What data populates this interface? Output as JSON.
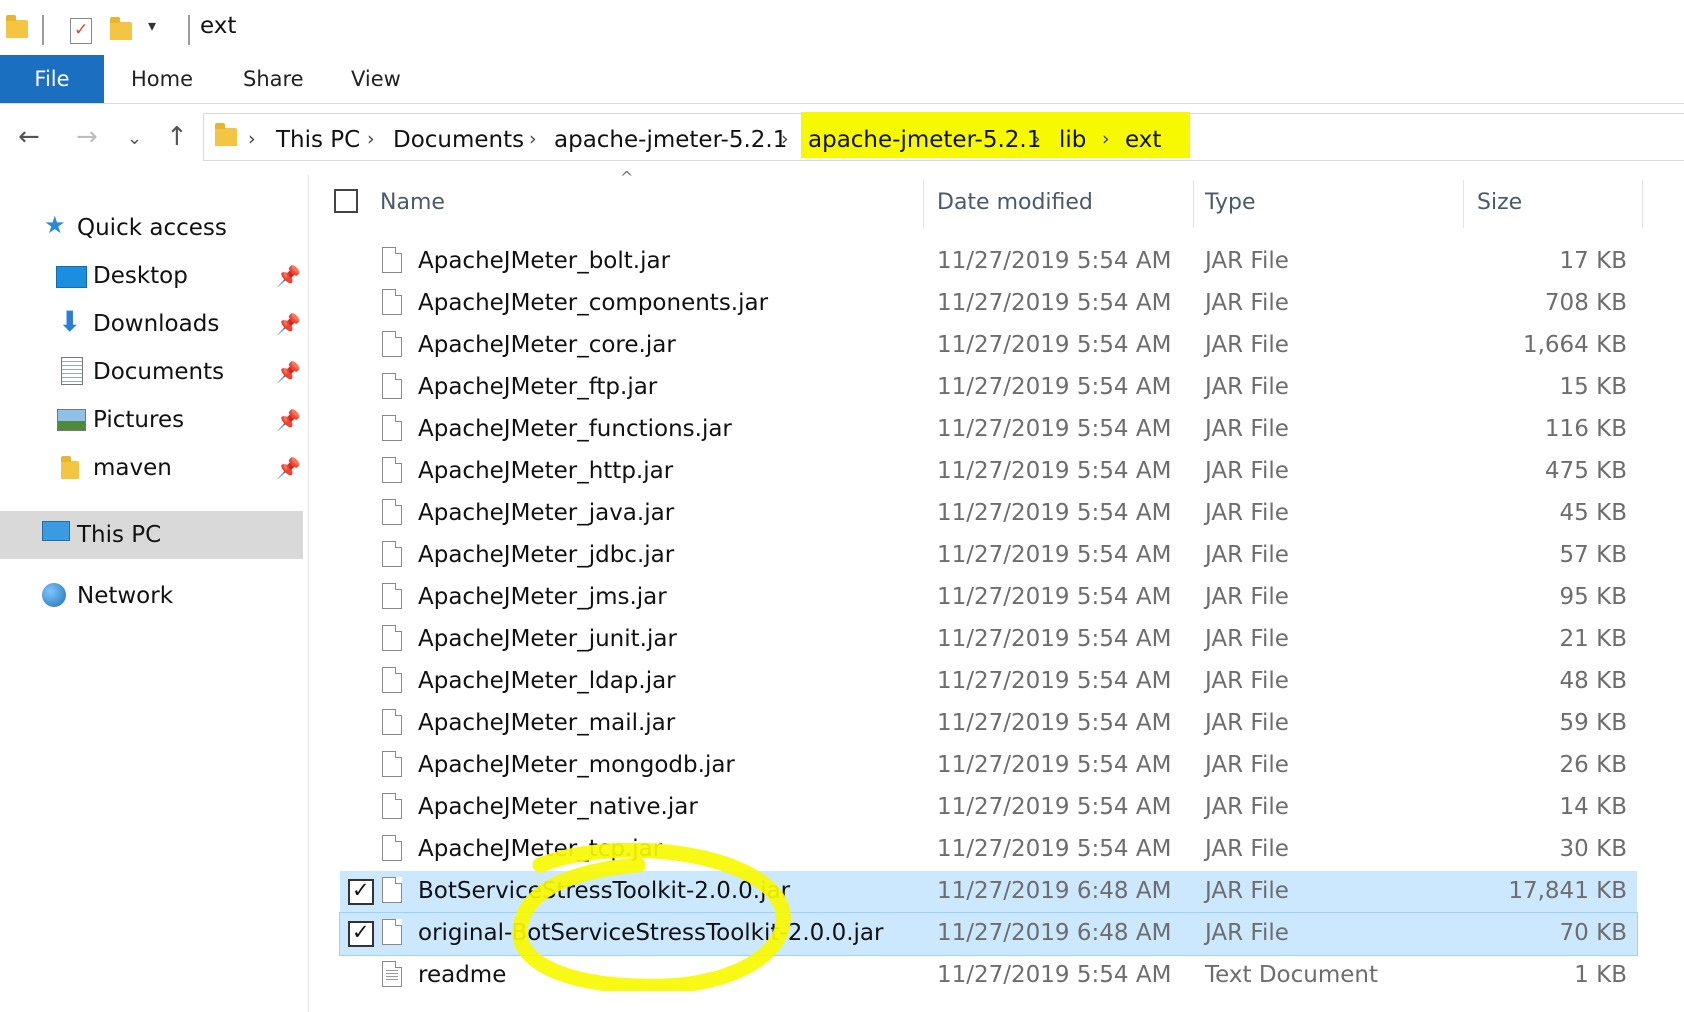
{
  "window": {
    "title": "ext"
  },
  "ribbon": {
    "tabs": [
      "File",
      "Home",
      "Share",
      "View"
    ]
  },
  "address": {
    "crumbs": [
      "This PC",
      "Documents",
      "apache-jmeter-5.2.1",
      "apache-jmeter-5.2.1",
      "lib",
      "ext"
    ]
  },
  "sidebar": {
    "quick_access": "Quick access",
    "items": [
      {
        "label": "Desktop",
        "icon": "desktop-icon",
        "pinned": true
      },
      {
        "label": "Downloads",
        "icon": "downloads-icon",
        "pinned": true
      },
      {
        "label": "Documents",
        "icon": "documents-icon",
        "pinned": true
      },
      {
        "label": "Pictures",
        "icon": "pictures-icon",
        "pinned": true
      },
      {
        "label": "maven",
        "icon": "folder-icon",
        "pinned": true
      }
    ],
    "this_pc": "This PC",
    "network": "Network"
  },
  "columns": {
    "name": "Name",
    "date": "Date modified",
    "type": "Type",
    "size": "Size"
  },
  "files": [
    {
      "name": "ApacheJMeter_bolt.jar",
      "date": "11/27/2019 5:54 AM",
      "type": "JAR File",
      "size": "17 KB",
      "selected": false
    },
    {
      "name": "ApacheJMeter_components.jar",
      "date": "11/27/2019 5:54 AM",
      "type": "JAR File",
      "size": "708 KB",
      "selected": false
    },
    {
      "name": "ApacheJMeter_core.jar",
      "date": "11/27/2019 5:54 AM",
      "type": "JAR File",
      "size": "1,664 KB",
      "selected": false
    },
    {
      "name": "ApacheJMeter_ftp.jar",
      "date": "11/27/2019 5:54 AM",
      "type": "JAR File",
      "size": "15 KB",
      "selected": false
    },
    {
      "name": "ApacheJMeter_functions.jar",
      "date": "11/27/2019 5:54 AM",
      "type": "JAR File",
      "size": "116 KB",
      "selected": false
    },
    {
      "name": "ApacheJMeter_http.jar",
      "date": "11/27/2019 5:54 AM",
      "type": "JAR File",
      "size": "475 KB",
      "selected": false
    },
    {
      "name": "ApacheJMeter_java.jar",
      "date": "11/27/2019 5:54 AM",
      "type": "JAR File",
      "size": "45 KB",
      "selected": false
    },
    {
      "name": "ApacheJMeter_jdbc.jar",
      "date": "11/27/2019 5:54 AM",
      "type": "JAR File",
      "size": "57 KB",
      "selected": false
    },
    {
      "name": "ApacheJMeter_jms.jar",
      "date": "11/27/2019 5:54 AM",
      "type": "JAR File",
      "size": "95 KB",
      "selected": false
    },
    {
      "name": "ApacheJMeter_junit.jar",
      "date": "11/27/2019 5:54 AM",
      "type": "JAR File",
      "size": "21 KB",
      "selected": false
    },
    {
      "name": "ApacheJMeter_ldap.jar",
      "date": "11/27/2019 5:54 AM",
      "type": "JAR File",
      "size": "48 KB",
      "selected": false
    },
    {
      "name": "ApacheJMeter_mail.jar",
      "date": "11/27/2019 5:54 AM",
      "type": "JAR File",
      "size": "59 KB",
      "selected": false
    },
    {
      "name": "ApacheJMeter_mongodb.jar",
      "date": "11/27/2019 5:54 AM",
      "type": "JAR File",
      "size": "26 KB",
      "selected": false
    },
    {
      "name": "ApacheJMeter_native.jar",
      "date": "11/27/2019 5:54 AM",
      "type": "JAR File",
      "size": "14 KB",
      "selected": false
    },
    {
      "name": "ApacheJMeter_tcp.jar",
      "date": "11/27/2019 5:54 AM",
      "type": "JAR File",
      "size": "30 KB",
      "selected": false
    },
    {
      "name": "BotServiceStressToolkit-2.0.0.jar",
      "date": "11/27/2019 6:48 AM",
      "type": "JAR File",
      "size": "17,841 KB",
      "selected": true
    },
    {
      "name": "original-BotServiceStressToolkit-2.0.0.jar",
      "date": "11/27/2019 6:48 AM",
      "type": "JAR File",
      "size": "70 KB",
      "selected": true
    },
    {
      "name": "readme",
      "date": "11/27/2019 5:54 AM",
      "type": "Text Document",
      "size": "1 KB",
      "selected": false
    }
  ],
  "colors": {
    "file_tab": "#1a6fc0",
    "selection": "#cce8ff",
    "highlight": "#f7f900",
    "sidebar_selected": "#d9d9d9"
  }
}
